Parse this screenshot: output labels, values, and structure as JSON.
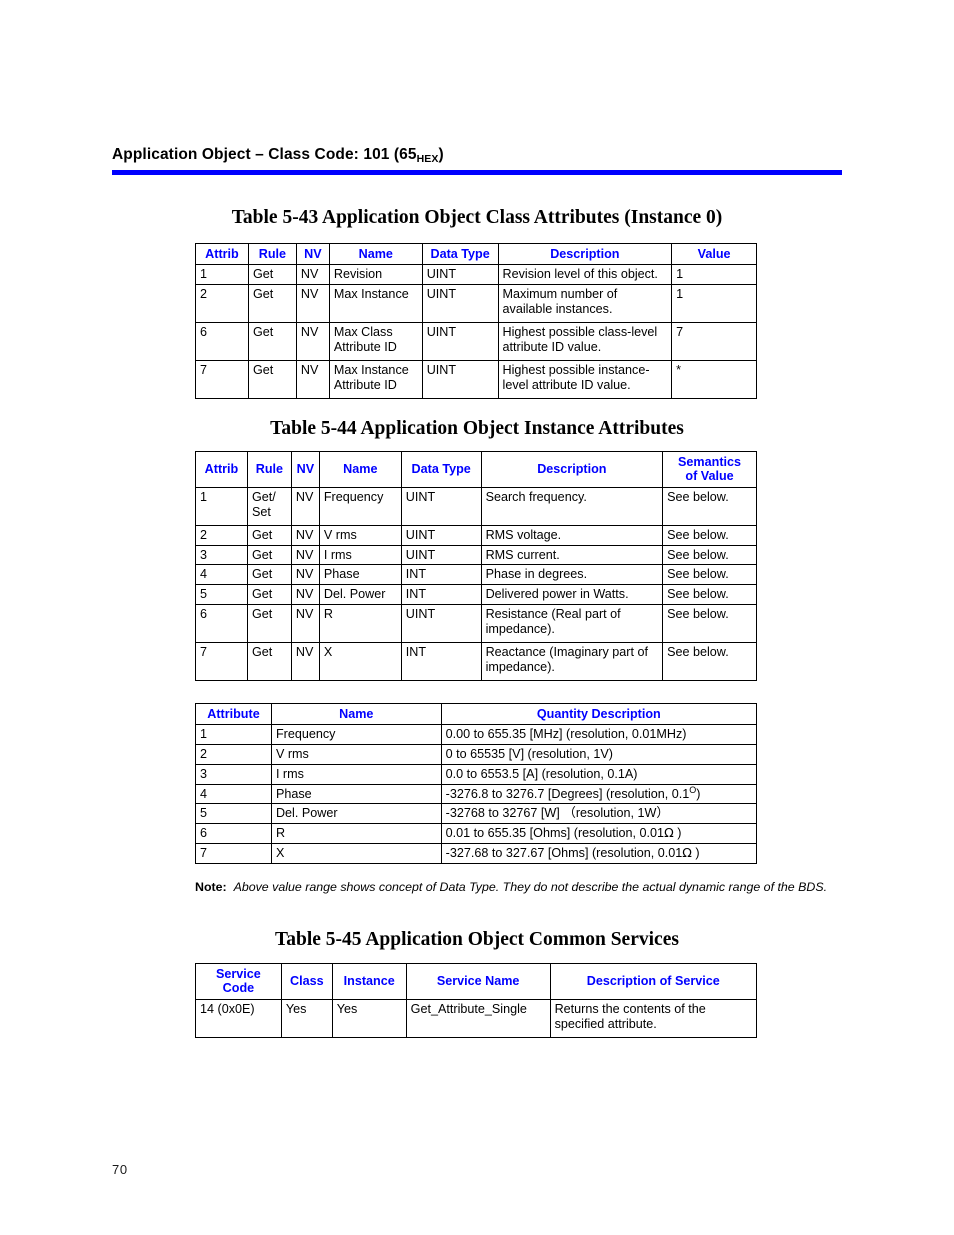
{
  "page": {
    "folio": "70",
    "header": {
      "title_main": "Application Object – Class Code: 101 (65",
      "title_sub": "HEX",
      "title_tail": ")",
      "rule_color": "#0000FF"
    },
    "accent_color": "#0000FF"
  },
  "table_543": {
    "title": "Table 5-43    Application Object Class Attributes (Instance 0)",
    "columns": [
      "Attrib",
      "Rule",
      "NV",
      "Name",
      "Data Type",
      "Description",
      "Value"
    ],
    "rows": [
      {
        "attrib": "1",
        "rule": "Get",
        "nv": "NV",
        "name": "Revision",
        "data_type": "UINT",
        "description": "Revision level of this object.",
        "value": "1"
      },
      {
        "attrib": "2",
        "rule": "Get",
        "nv": "NV",
        "name": "Max Instance",
        "data_type": "UINT",
        "description": "Maximum number of available instances.",
        "value": "1"
      },
      {
        "attrib": "6",
        "rule": "Get",
        "nv": "NV",
        "name": "Max Class Attribute ID",
        "data_type": "UINT",
        "description": "Highest possible class-level attribute ID value.",
        "value": "7"
      },
      {
        "attrib": "7",
        "rule": "Get",
        "nv": "NV",
        "name": "Max Instance Attribute ID",
        "data_type": "UINT",
        "description": "Highest possible instance-level attribute ID value.",
        "value": "*"
      }
    ]
  },
  "table_544": {
    "title": "Table 5-44    Application Object Instance Attributes",
    "columns": [
      "Attrib",
      "Rule",
      "NV",
      "Name",
      "Data Type",
      "Description",
      "Semantics of Value"
    ],
    "rows": [
      {
        "attrib": "1",
        "rule": "Get/ Set",
        "nv": "NV",
        "name": "Frequency",
        "data_type": "UINT",
        "description": "Search frequency.",
        "semantics": "See below."
      },
      {
        "attrib": "2",
        "rule": "Get",
        "nv": "NV",
        "name": "V rms",
        "data_type": "UINT",
        "description": "RMS voltage.",
        "semantics": "See below."
      },
      {
        "attrib": "3",
        "rule": "Get",
        "nv": "NV",
        "name": "I rms",
        "data_type": "UINT",
        "description": "RMS current.",
        "semantics": "See below."
      },
      {
        "attrib": "4",
        "rule": "Get",
        "nv": "NV",
        "name": "Phase",
        "data_type": "INT",
        "description": "Phase in degrees.",
        "semantics": "See below."
      },
      {
        "attrib": "5",
        "rule": "Get",
        "nv": "NV",
        "name": "Del. Power",
        "data_type": "INT",
        "description": "Delivered power in Watts.",
        "semantics": "See below."
      },
      {
        "attrib": "6",
        "rule": "Get",
        "nv": "NV",
        "name": "R",
        "data_type": "UINT",
        "description": "Resistance (Real part of impedance).",
        "semantics": "See below."
      },
      {
        "attrib": "7",
        "rule": "Get",
        "nv": "NV",
        "name": "X",
        "data_type": "INT",
        "description": "Reactance (Imaginary part of impedance).",
        "semantics": "See below."
      }
    ]
  },
  "table_quantity": {
    "columns": [
      "Attribute",
      "Name",
      "Quantity Description"
    ],
    "rows": [
      {
        "attribute": "1",
        "name": "Frequency",
        "quantity": "0.00 to 655.35 [MHz] (resolution, 0.01MHz)"
      },
      {
        "attribute": "2",
        "name": "V rms",
        "quantity": "0 to 65535 [V] (resolution, 1V)"
      },
      {
        "attribute": "3",
        "name": "I rms",
        "quantity": "0.0 to 6553.5 [A] (resolution, 0.1A)"
      },
      {
        "attribute": "4",
        "name": "Phase",
        "quantity": "-3276.8 to 3276.7 [Degrees] (resolution, 0.1°)"
      },
      {
        "attribute": "5",
        "name": "Del. Power",
        "quantity": "-32768 to 32767    [W]    （resolution, 1W）"
      },
      {
        "attribute": "6",
        "name": "R",
        "quantity": "0.01 to 655.35 [Ohms] (resolution, 0.01Ω )"
      },
      {
        "attribute": "7",
        "name": "X",
        "quantity": "-327.68 to 327.67 [Ohms] (resolution, 0.01Ω )"
      }
    ]
  },
  "note": {
    "label": "Note:",
    "text": "Above value range shows concept of Data Type. They do not describe the actual dynamic range of the BDS."
  },
  "table_545": {
    "title": "Table 5-45    Application Object Common Services",
    "columns": [
      "Service Code",
      "Class",
      "Instance",
      "Service Name",
      "Description of Service"
    ],
    "rows": [
      {
        "service_code": "14 (0x0E)",
        "class": "Yes",
        "instance": "Yes",
        "service_name": "Get_Attribute_Single",
        "description": "Returns the contents of the specified attribute."
      }
    ]
  }
}
